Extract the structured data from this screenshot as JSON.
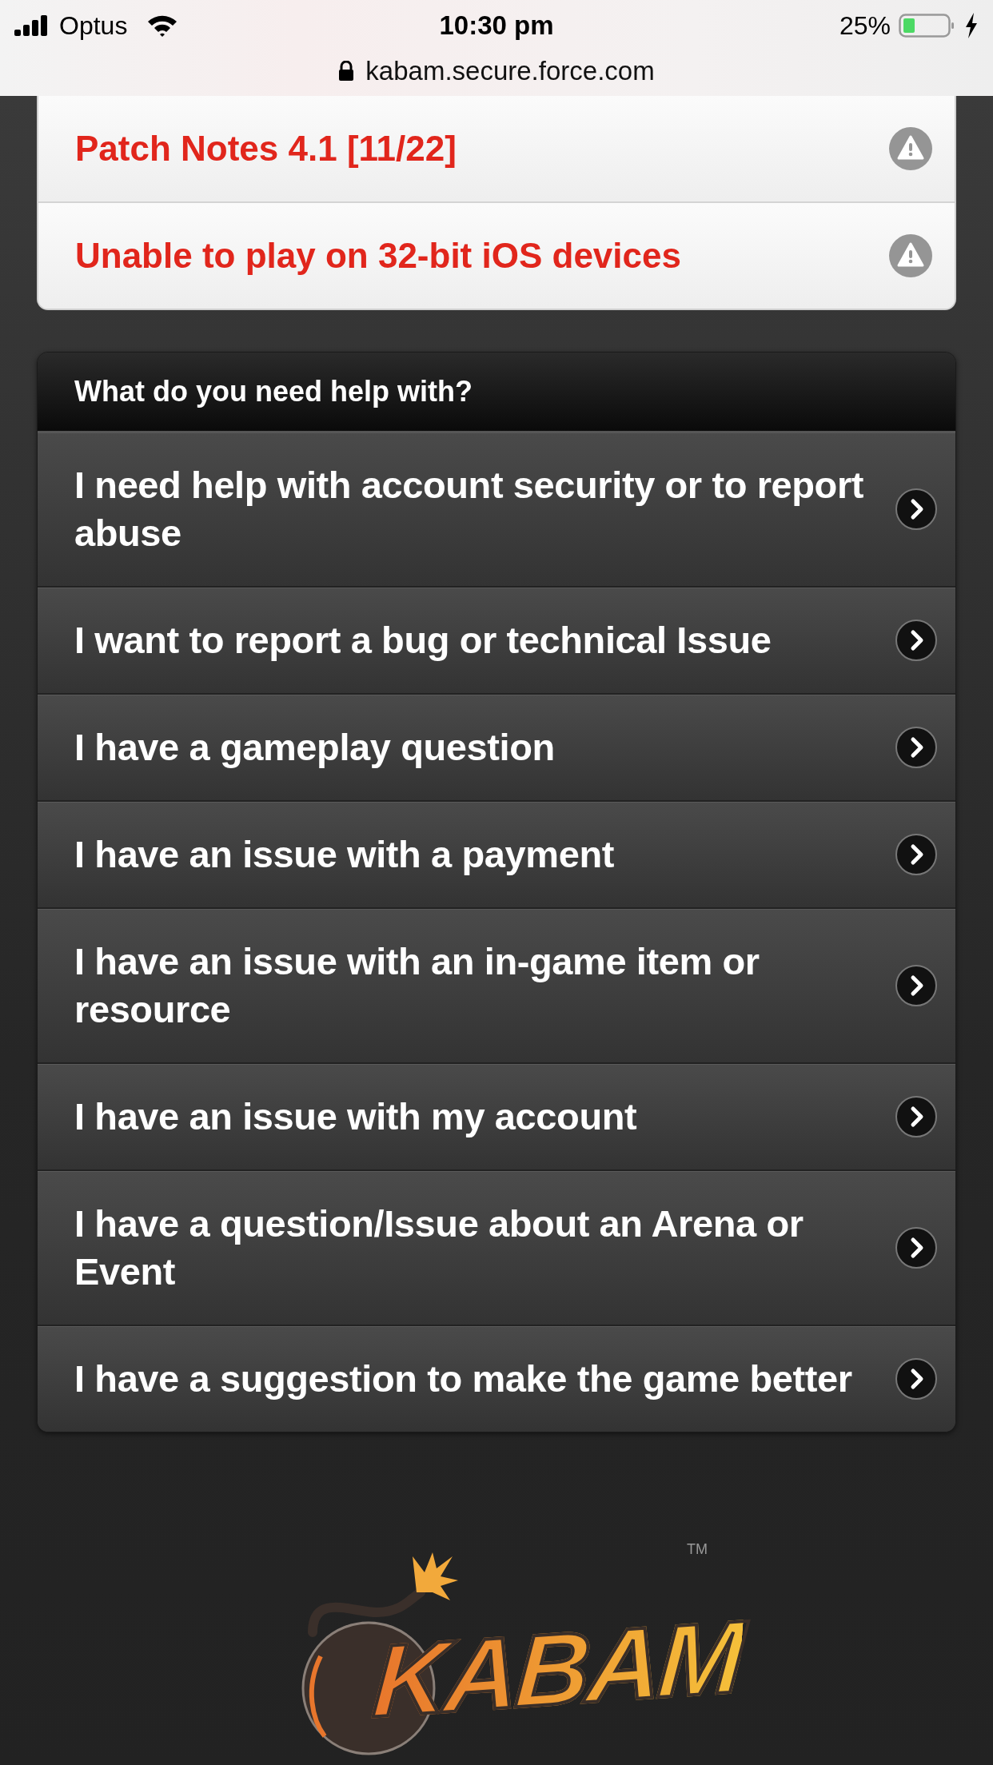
{
  "status_bar": {
    "carrier": "Optus",
    "time": "10:30 pm",
    "battery": "25%"
  },
  "address_bar": {
    "url": "kabam.secure.force.com"
  },
  "alerts": [
    {
      "title": "Patch Notes 4.1 [11/22]"
    },
    {
      "title": "Unable to play on 32-bit iOS devices"
    }
  ],
  "help_panel": {
    "title": "What do you need help with?",
    "items": [
      {
        "label": "I need help with account security or to report abuse"
      },
      {
        "label": "I want to report a bug or technical Issue"
      },
      {
        "label": "I have a gameplay question"
      },
      {
        "label": "I have an issue with a payment"
      },
      {
        "label": "I have an issue with an in-game item or resource"
      },
      {
        "label": "I have an issue with my account"
      },
      {
        "label": "I have a question/Issue about an Arena or Event"
      },
      {
        "label": "I have a suggestion to make the game better"
      }
    ]
  },
  "logo": {
    "wordmark": "KABAM",
    "trademark": "TM"
  }
}
